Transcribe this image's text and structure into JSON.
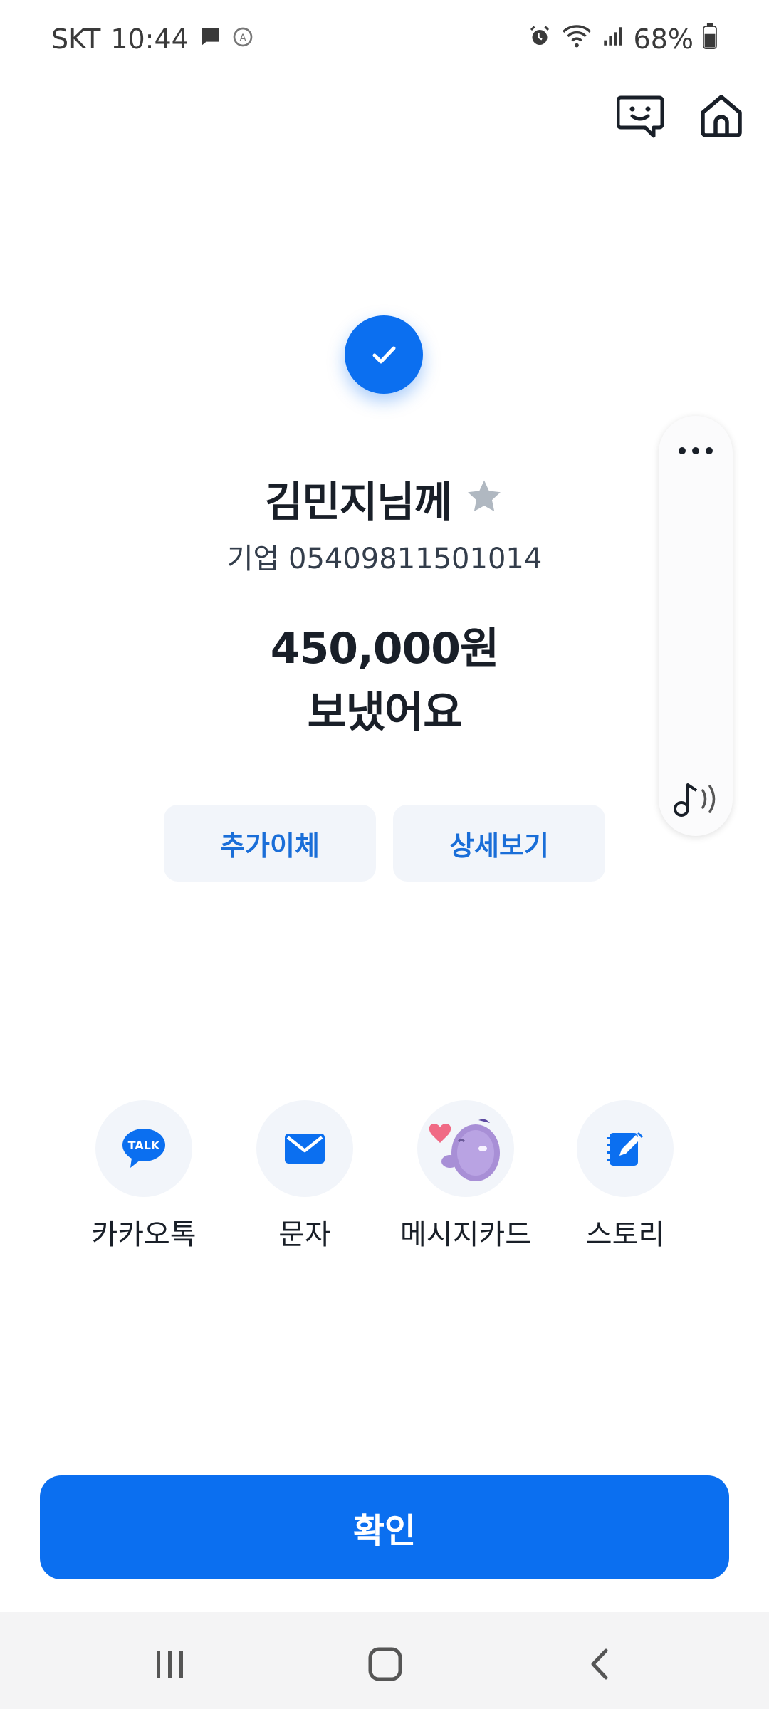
{
  "status_bar": {
    "carrier": "SKT",
    "time": "10:44",
    "battery": "68%"
  },
  "recipient": {
    "name": "김민지님께",
    "account": "기업 05409811501014"
  },
  "transfer": {
    "amount": "450,000원",
    "status": "보냈어요"
  },
  "actions": {
    "additional_transfer": "추가이체",
    "details": "상세보기"
  },
  "share": {
    "items": [
      {
        "label": "카카오톡",
        "icon": "kakaotalk-icon",
        "icon_text": "TALK"
      },
      {
        "label": "문자",
        "icon": "mail-icon"
      },
      {
        "label": "메시지카드",
        "icon": "message-card-character-icon"
      },
      {
        "label": "스토리",
        "icon": "edit-note-icon"
      }
    ]
  },
  "confirm_label": "확인",
  "colors": {
    "primary": "#0b6ff0",
    "button_bg": "#f2f5fa",
    "button_text": "#1a6ed8",
    "star": "#b0b8c1"
  }
}
